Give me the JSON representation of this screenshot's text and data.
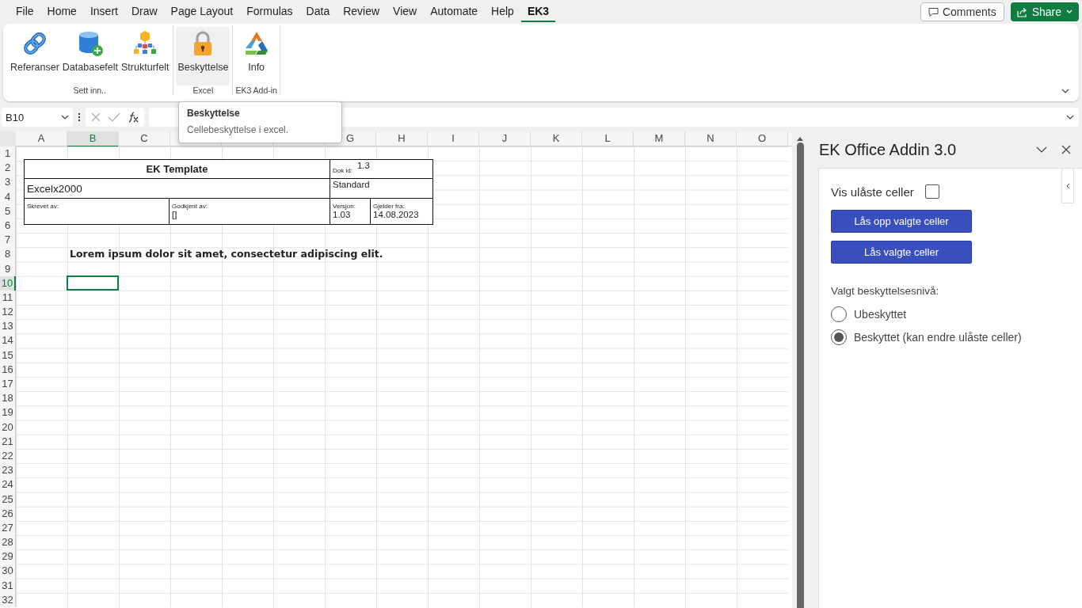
{
  "menu_tabs": [
    {
      "label": "File",
      "selected": false
    },
    {
      "label": "Home",
      "selected": false
    },
    {
      "label": "Insert",
      "selected": false
    },
    {
      "label": "Draw",
      "selected": false
    },
    {
      "label": "Page Layout",
      "selected": false
    },
    {
      "label": "Formulas",
      "selected": false
    },
    {
      "label": "Data",
      "selected": false
    },
    {
      "label": "Review",
      "selected": false
    },
    {
      "label": "View",
      "selected": false
    },
    {
      "label": "Automate",
      "selected": false
    },
    {
      "label": "Help",
      "selected": false
    },
    {
      "label": "EK3",
      "selected": true
    }
  ],
  "header_buttons": {
    "comments": "Comments",
    "share": "Share"
  },
  "ribbon": {
    "groups": [
      {
        "label": "Sett inn..",
        "buttons": [
          {
            "label": "Referanser",
            "hovered": false
          },
          {
            "label": "Databasefelt",
            "hovered": false
          },
          {
            "label": "Strukturfelt",
            "hovered": false
          }
        ]
      },
      {
        "label": "Excel",
        "buttons": [
          {
            "label": "Beskyttelse",
            "hovered": true
          }
        ]
      },
      {
        "label": "EK3 Add-in",
        "buttons": [
          {
            "label": "Info",
            "hovered": false
          }
        ]
      }
    ]
  },
  "name_box": "B10",
  "tooltip": {
    "title": "Beskyttelse",
    "text": "Cellebeskyttelse i excel."
  },
  "sheet": {
    "columns": [
      {
        "label": "A",
        "selected": false
      },
      {
        "label": "B",
        "selected": true
      },
      {
        "label": "C",
        "selected": false
      },
      {},
      {},
      {},
      {
        "label": "G",
        "selected": false
      },
      {
        "label": "H",
        "selected": false
      },
      {
        "label": "I",
        "selected": false
      },
      {
        "label": "J",
        "selected": false
      },
      {
        "label": "K",
        "selected": false
      },
      {
        "label": "L",
        "selected": false
      },
      {
        "label": "M",
        "selected": false
      },
      {
        "label": "N",
        "selected": false
      },
      {
        "label": "O",
        "selected": false
      }
    ],
    "rows": [
      {
        "label": "1",
        "selected": false
      },
      {
        "label": "2",
        "selected": false
      },
      {
        "label": "3",
        "selected": false
      },
      {
        "label": "4",
        "selected": false
      },
      {
        "label": "5",
        "selected": false
      },
      {
        "label": "6",
        "selected": false
      },
      {
        "label": "7",
        "selected": false
      },
      {
        "label": "8",
        "selected": false
      },
      {
        "label": "9",
        "selected": false
      },
      {
        "label": "10",
        "selected": true
      },
      {
        "label": "11",
        "selected": false
      },
      {
        "label": "12",
        "selected": false
      },
      {
        "label": "13",
        "selected": false
      },
      {
        "label": "14",
        "selected": false
      },
      {
        "label": "15",
        "selected": false
      },
      {
        "label": "16",
        "selected": false
      },
      {
        "label": "17",
        "selected": false
      },
      {
        "label": "18",
        "selected": false
      },
      {
        "label": "19",
        "selected": false
      },
      {
        "label": "20",
        "selected": false
      },
      {
        "label": "21",
        "selected": false
      },
      {
        "label": "22",
        "selected": false
      },
      {
        "label": "23",
        "selected": false
      },
      {
        "label": "24",
        "selected": false
      },
      {
        "label": "25",
        "selected": false
      },
      {
        "label": "26",
        "selected": false
      },
      {
        "label": "27",
        "selected": false
      },
      {
        "label": "28",
        "selected": false
      },
      {
        "label": "29",
        "selected": false
      },
      {
        "label": "30",
        "selected": false
      },
      {
        "label": "31",
        "selected": false
      },
      {
        "label": "32",
        "selected": false
      }
    ],
    "template": {
      "title": "EK Template",
      "doc_id_label": "Dok id:",
      "doc_id": "1.3",
      "name": "Excelx2000",
      "type": "Standard",
      "written_by_label": "Skrevet av:",
      "approved_by_label": "Godkjent av:",
      "approved_by": "[]",
      "version_label": "Versjon:",
      "version": "1.03",
      "valid_from_label": "Gjelder fra:",
      "valid_from": "14.08.2023"
    },
    "note": "Lorem ipsum dolor sit amet, consectetur adipiscing elit."
  },
  "task_pane": {
    "title": "EK Office Addin 3.0",
    "checkbox": {
      "label": "Vis ulåste celler",
      "checked": false
    },
    "buttons": [
      "Lås opp valgte celler",
      "Lås valgte celler"
    ],
    "radio_label": "Valgt beskyttelsesnivå:",
    "options": [
      {
        "label": "Ubeskyttet",
        "selected": false
      },
      {
        "label": "Beskyttet (kan endre ulåste celler)",
        "selected": true
      }
    ]
  }
}
